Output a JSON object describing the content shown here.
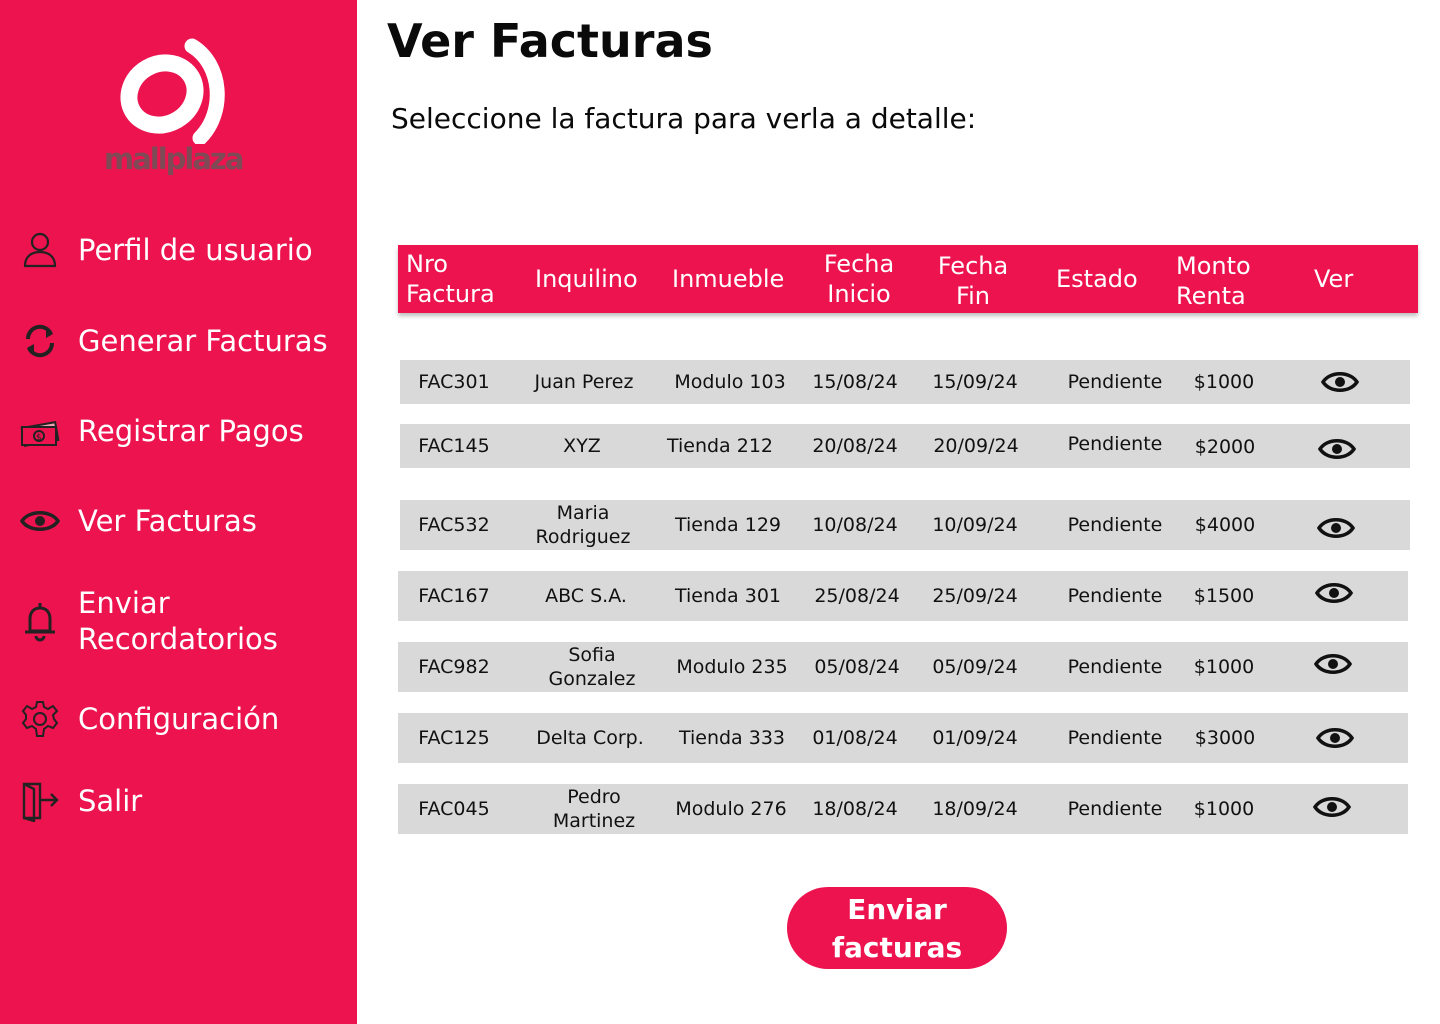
{
  "brand": {
    "logo_text": "mallplaza",
    "accent_color": "#ec134f"
  },
  "sidebar": {
    "items": [
      {
        "label": "Perfil de usuario",
        "icon": "user-icon"
      },
      {
        "label": "Generar Facturas",
        "icon": "refresh-icon"
      },
      {
        "label": "Registrar Pagos",
        "icon": "money-icon"
      },
      {
        "label": "Ver Facturas",
        "icon": "eye-icon"
      },
      {
        "label": "Enviar Recordatorios",
        "icon": "bell-icon"
      },
      {
        "label": "Configuración",
        "icon": "gear-icon"
      },
      {
        "label": "Salir",
        "icon": "logout-icon"
      }
    ]
  },
  "main": {
    "title": "Ver Facturas",
    "subtitle": "Seleccione la factura para verla a  detalle:",
    "send_button": "Enviar facturas"
  },
  "table": {
    "headers": [
      "Nro Factura",
      "Inquilino",
      "Inmueble",
      "Fecha Inicio",
      "Fecha Fin",
      "Estado",
      "Monto Renta",
      "Ver"
    ],
    "rows": [
      {
        "nro": "FAC301",
        "inquilino": "Juan Perez",
        "inmueble": "Modulo 103",
        "inicio": "15/08/24",
        "fin": "15/09/24",
        "estado": "Pendiente",
        "monto": "$1000"
      },
      {
        "nro": "FAC145",
        "inquilino": "XYZ",
        "inmueble": "Tienda 212",
        "inicio": "20/08/24",
        "fin": "20/09/24",
        "estado": "Pendiente",
        "monto": "$2000"
      },
      {
        "nro": "FAC532",
        "inquilino": "Maria Rodriguez",
        "inmueble": "Tienda 129",
        "inicio": "10/08/24",
        "fin": "10/09/24",
        "estado": "Pendiente",
        "monto": "$4000"
      },
      {
        "nro": "FAC167",
        "inquilino": "ABC S.A.",
        "inmueble": "Tienda 301",
        "inicio": "25/08/24",
        "fin": "25/09/24",
        "estado": "Pendiente",
        "monto": "$1500"
      },
      {
        "nro": "FAC982",
        "inquilino": "Sofia Gonzalez",
        "inmueble": "Modulo 235",
        "inicio": "05/08/24",
        "fin": "05/09/24",
        "estado": "Pendiente",
        "monto": "$1000"
      },
      {
        "nro": "FAC125",
        "inquilino": "Delta Corp.",
        "inmueble": "Tienda 333",
        "inicio": "01/08/24",
        "fin": "01/09/24",
        "estado": "Pendiente",
        "monto": "$3000"
      },
      {
        "nro": "FAC045",
        "inquilino": "Pedro Martinez",
        "inmueble": "Modulo 276",
        "inicio": "18/08/24",
        "fin": "18/09/24",
        "estado": "Pendiente",
        "monto": "$1000"
      }
    ]
  }
}
